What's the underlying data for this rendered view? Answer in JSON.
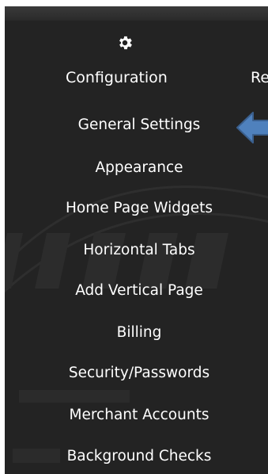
{
  "header": {
    "configuration_label": "Configuration",
    "next_tab_partial": "Re"
  },
  "icons": {
    "configuration": "gear-icon",
    "pointer": "arrow-left-icon"
  },
  "colors": {
    "panel_background": "#232323",
    "text": "#ffffff",
    "arrow_fill": "#4f81bd",
    "arrow_stroke": "#3a5f8d"
  },
  "menu": {
    "items": [
      {
        "label": "General Settings"
      },
      {
        "label": "Appearance"
      },
      {
        "label": "Home Page Widgets"
      },
      {
        "label": "Horizontal Tabs"
      },
      {
        "label": "Add Vertical Page"
      },
      {
        "label": "Billing"
      },
      {
        "label": "Security/Passwords"
      },
      {
        "label": "Merchant Accounts"
      },
      {
        "label": "Background Checks"
      }
    ]
  }
}
